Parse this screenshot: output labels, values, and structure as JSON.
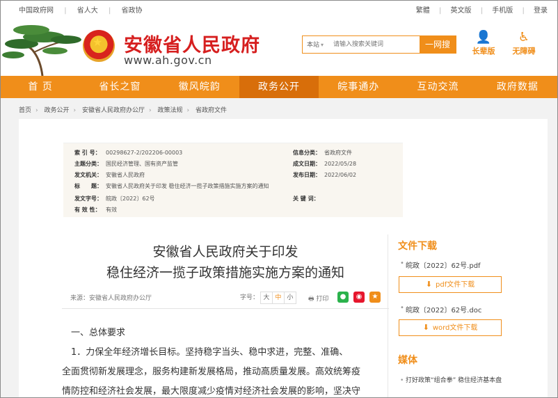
{
  "topbar": {
    "left": [
      "中国政府网",
      "省人大",
      "省政协"
    ],
    "right": [
      "繁體",
      "英文版",
      "手机版",
      "登录"
    ]
  },
  "header": {
    "site_name": "安徽省人民政府",
    "site_url": "www.ah.gov.cn",
    "search_scope": "本站",
    "search_placeholder": "请输入搜索关键词",
    "search_button": "一网搜",
    "tool_elder": "长辈版",
    "tool_access": "无障碍"
  },
  "nav": [
    "首 页",
    "省长之窗",
    "徽风皖韵",
    "政务公开",
    "皖事通办",
    "互动交流",
    "政府数据"
  ],
  "nav_active": 3,
  "breadcrumb": [
    "首页",
    "政务公开",
    "安徽省人民政府办公厅",
    "政策法规",
    "省政府文件"
  ],
  "meta": {
    "index_label": "索 引 号：",
    "index_value": "00298627-2/202206-00003",
    "info_cat_label": "信息分类：",
    "info_cat_value": "省政府文件",
    "topic_label": "主题分类：",
    "topic_value": "国民经济管理、国有资产监管",
    "created_label": "成文日期：",
    "created_value": "2022/05/28",
    "issuer_label": "发文机关：",
    "issuer_value": "安徽省人民政府",
    "published_label": "发布日期：",
    "published_value": "2022/06/02",
    "title_label": "标　　题：",
    "title_value": "安徽省人民政府关于印发 稳住经济一揽子政策措施实施方案的通知",
    "docno_label": "发文字号：",
    "docno_value": "皖政〔2022〕62号",
    "keywords_label": "关 键 词：",
    "keywords_value": "",
    "validity_label": "有 效 性：",
    "validity_value": "有效"
  },
  "article": {
    "title_line1": "安徽省人民政府关于印发",
    "title_line2": "稳住经济一揽子政策措施实施方案的通知",
    "source": "来源：安徽省人民政府办公厅",
    "fontsize_label": "字号：",
    "size_large": "大",
    "size_medium": "中",
    "size_small": "小",
    "print": "打印",
    "para1": "　一、总体要求",
    "para2": "　1．力保全年经济增长目标。坚持稳字当头、稳中求进，完整、准确、",
    "para3": "全面贯彻新发展理念，服务构建新发展格局，推动高质量发展。高效统筹疫",
    "para4": "情防控和经济社会发展，最大限度减少疫情对经济社会发展的影响，坚决守"
  },
  "sidebar": {
    "download_title": "文件下载",
    "file1": "皖政〔2022〕62号.pdf",
    "file1_button": "pdf文件下载",
    "file2": "皖政〔2022〕62号.doc",
    "file2_button": "word文件下载",
    "media_title": "媒体",
    "media_item": "打好政策“组合拳” 稳住经济基本盘"
  },
  "colors": {
    "accent": "#f08e1a",
    "brand_red": "#d61f1f",
    "nav_active": "#d86e0a"
  }
}
